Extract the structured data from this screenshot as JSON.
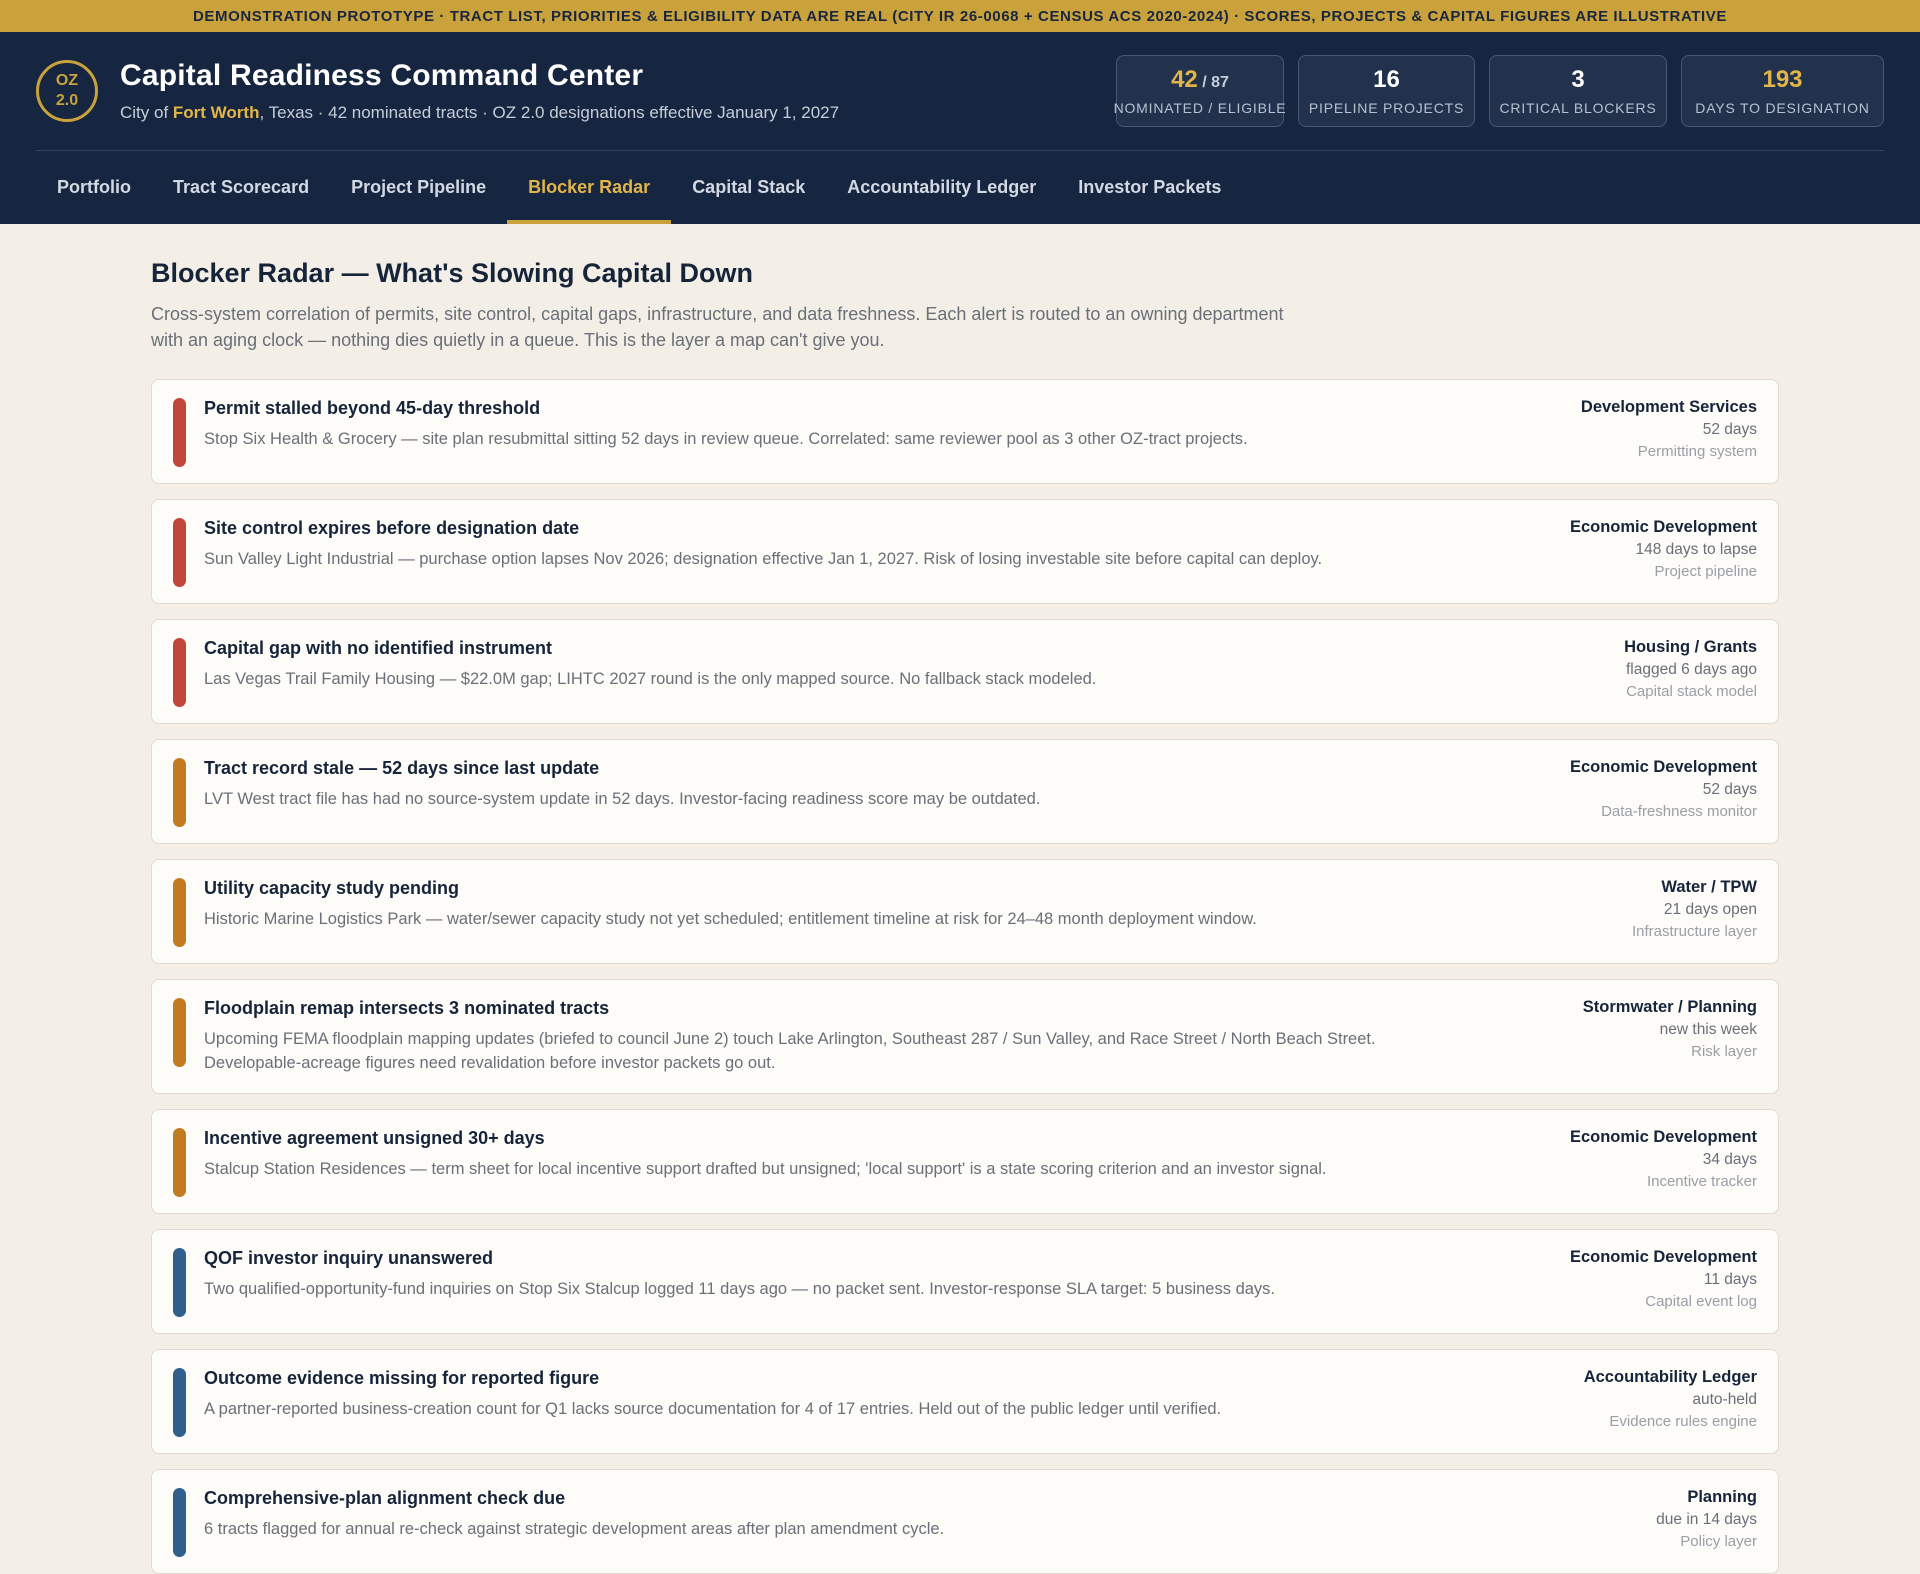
{
  "banner": {
    "text": "DEMONSTRATION PROTOTYPE · TRACT LIST, PRIORITIES & ELIGIBILITY DATA ARE REAL (CITY IR 26-0068 + CENSUS ACS 2020-2024) · SCORES, PROJECTS & CAPITAL FIGURES ARE ILLUSTRATIVE"
  },
  "header": {
    "logo_line1": "OZ",
    "logo_line2": "2.0",
    "title": "Capital Readiness Command Center",
    "subtitle_prefix": "City of ",
    "subtitle_city": "Fort Worth",
    "subtitle_rest": ", Texas · 42 nominated tracts · OZ 2.0 designations effective January 1, 2027",
    "stats": [
      {
        "value": "42",
        "suffix": " / 87",
        "label": "NOMINATED / ELIGIBLE"
      },
      {
        "value": "16",
        "suffix": "",
        "label": "PIPELINE PROJECTS"
      },
      {
        "value": "3",
        "suffix": "",
        "label": "CRITICAL BLOCKERS"
      },
      {
        "value": "193",
        "suffix": "",
        "label": "DAYS TO DESIGNATION"
      }
    ]
  },
  "nav": {
    "tabs": [
      {
        "label": "Portfolio"
      },
      {
        "label": "Tract Scorecard"
      },
      {
        "label": "Project Pipeline"
      },
      {
        "label": "Blocker Radar"
      },
      {
        "label": "Capital Stack"
      },
      {
        "label": "Accountability Ledger"
      },
      {
        "label": "Investor Packets"
      }
    ],
    "active": "Blocker Radar"
  },
  "main": {
    "title": "Blocker Radar — What's Slowing Capital Down",
    "description": "Cross-system correlation of permits, site control, capital gaps, infrastructure, and data freshness. Each alert is routed to an owning department with an aging clock — nothing dies quietly in a queue. This is the layer a map can't give you."
  },
  "colors": {
    "critical": "#c0463a",
    "warning": "#c27b22",
    "info": "#2f5f8c",
    "gold": "#c9a23c",
    "navy": "#172640"
  },
  "alerts": [
    {
      "severity": "critical",
      "title": "Permit stalled beyond 45-day threshold",
      "description": "Stop Six Health & Grocery — site plan resubmittal sitting 52 days in review queue. Correlated: same reviewer pool as 3 other OZ-tract projects.",
      "owner": "Development Services",
      "age": "52 days",
      "source": "Permitting system"
    },
    {
      "severity": "critical",
      "title": "Site control expires before designation date",
      "description": "Sun Valley Light Industrial — purchase option lapses Nov 2026; designation effective Jan 1, 2027. Risk of losing investable site before capital can deploy.",
      "owner": "Economic Development",
      "age": "148 days to lapse",
      "source": "Project pipeline"
    },
    {
      "severity": "critical",
      "title": "Capital gap with no identified instrument",
      "description": "Las Vegas Trail Family Housing — $22.0M gap; LIHTC 2027 round is the only mapped source. No fallback stack modeled.",
      "owner": "Housing / Grants",
      "age": "flagged 6 days ago",
      "source": "Capital stack model"
    },
    {
      "severity": "warning",
      "title": "Tract record stale — 52 days since last update",
      "description": "LVT West tract file has had no source-system update in 52 days. Investor-facing readiness score may be outdated.",
      "owner": "Economic Development",
      "age": "52 days",
      "source": "Data-freshness monitor"
    },
    {
      "severity": "warning",
      "title": "Utility capacity study pending",
      "description": "Historic Marine Logistics Park — water/sewer capacity study not yet scheduled; entitlement timeline at risk for 24–48 month deployment window.",
      "owner": "Water / TPW",
      "age": "21 days open",
      "source": "Infrastructure layer"
    },
    {
      "severity": "warning",
      "title": "Floodplain remap intersects 3 nominated tracts",
      "description": "Upcoming FEMA floodplain mapping updates (briefed to council June 2) touch Lake Arlington, Southeast 287 / Sun Valley, and Race Street / North Beach Street. Developable-acreage figures need revalidation before investor packets go out.",
      "owner": "Stormwater / Planning",
      "age": "new this week",
      "source": "Risk layer"
    },
    {
      "severity": "warning",
      "title": "Incentive agreement unsigned 30+ days",
      "description": "Stalcup Station Residences — term sheet for local incentive support drafted but unsigned; 'local support' is a state scoring criterion and an investor signal.",
      "owner": "Economic Development",
      "age": "34 days",
      "source": "Incentive tracker"
    },
    {
      "severity": "info",
      "title": "QOF investor inquiry unanswered",
      "description": "Two qualified-opportunity-fund inquiries on Stop Six Stalcup logged 11 days ago — no packet sent. Investor-response SLA target: 5 business days.",
      "owner": "Economic Development",
      "age": "11 days",
      "source": "Capital event log"
    },
    {
      "severity": "info",
      "title": "Outcome evidence missing for reported figure",
      "description": "A partner-reported business-creation count for Q1 lacks source documentation for 4 of 17 entries. Held out of the public ledger until verified.",
      "owner": "Accountability Ledger",
      "age": "auto-held",
      "source": "Evidence rules engine"
    },
    {
      "severity": "info",
      "title": "Comprehensive-plan alignment check due",
      "description": "6 tracts flagged for annual re-check against strategic development areas after plan amendment cycle.",
      "owner": "Planning",
      "age": "due in 14 days",
      "source": "Policy layer"
    }
  ]
}
